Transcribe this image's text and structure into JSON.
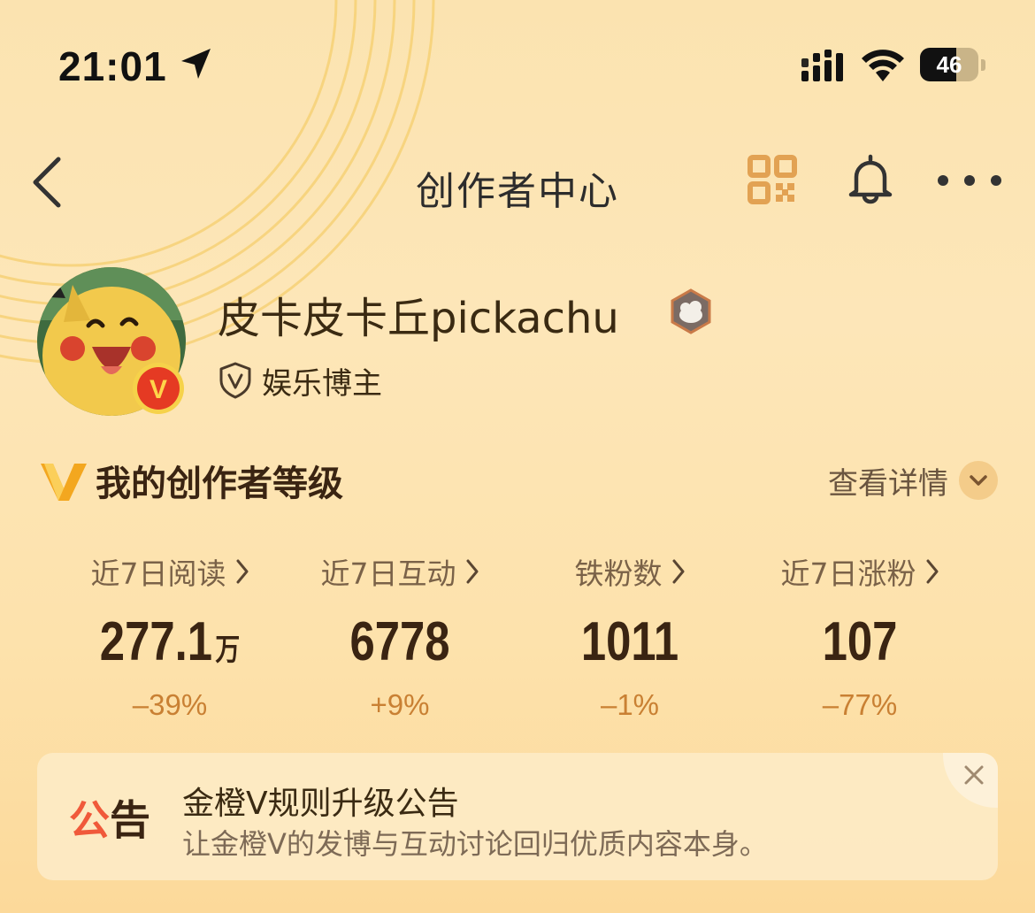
{
  "status_bar": {
    "time": "21:01",
    "battery": "46",
    "icons": [
      "location-arrow-icon",
      "signal-icon",
      "wifi-icon",
      "battery-icon"
    ]
  },
  "nav": {
    "title": "创作者中心",
    "icons": [
      "back-chevron-icon",
      "qr-code-icon",
      "bell-icon",
      "more-dots-icon"
    ]
  },
  "profile": {
    "username": "皮卡皮卡丘pickachu",
    "tag": "娱乐博主",
    "verified_badge": "V"
  },
  "level_section": {
    "title": "我的创作者等级",
    "detail_link": "查看详情"
  },
  "stats": [
    {
      "label": "近7日阅读",
      "value": "277.1",
      "unit": "万",
      "change": "–39%"
    },
    {
      "label": "近7日互动",
      "value": "6778",
      "unit": "",
      "change": "+9%"
    },
    {
      "label": "铁粉数",
      "value": "1011",
      "unit": "",
      "change": "–1%"
    },
    {
      "label": "近7日涨粉",
      "value": "107",
      "unit": "",
      "change": "–77%"
    }
  ],
  "notice": {
    "label_part1": "公",
    "label_part2": "告",
    "title": "金橙V规则升级公告",
    "subtitle": "让金橙V的发博与互动讨论回归优质内容本身。"
  },
  "colors": {
    "background": "#fde4b2",
    "accent_orange": "#c98033",
    "notice_red": "#f0593a",
    "text_dark": "#3a2412"
  }
}
